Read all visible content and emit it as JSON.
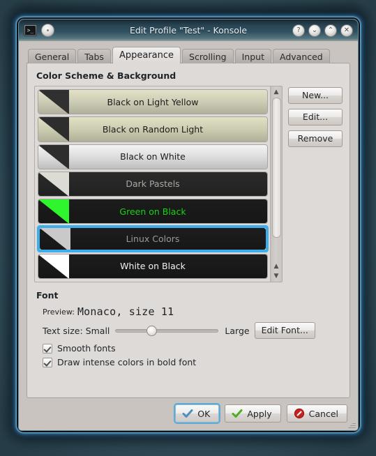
{
  "window": {
    "title": "Edit Profile \"Test\" - Konsole",
    "app_icon": "konsole-terminal-icon",
    "pin_icon": "pin-button-icon",
    "controls": {
      "help": "?",
      "minimize": "⌄",
      "maximize": "⌃",
      "close": "✕"
    }
  },
  "tabs": [
    {
      "label": "General",
      "active": false
    },
    {
      "label": "Tabs",
      "active": false
    },
    {
      "label": "Appearance",
      "active": true
    },
    {
      "label": "Scrolling",
      "active": false
    },
    {
      "label": "Input",
      "active": false
    },
    {
      "label": "Advanced",
      "active": false
    }
  ],
  "color_scheme_group": {
    "title": "Color Scheme & Background",
    "items": [
      {
        "label": "Black on Light Yellow",
        "bg": "#e3e2c8",
        "fg": "#1b1b1b",
        "corner": "#303030",
        "selected": false
      },
      {
        "label": "Black on Random Light",
        "bg": "#e2e1c3",
        "fg": "#1b1b1b",
        "corner": "#2d2d2d",
        "selected": false
      },
      {
        "label": "Black on White",
        "bg": "#f4f4f4",
        "fg": "#1b1b1b",
        "corner": "#2d2d2d",
        "selected": false
      },
      {
        "label": "Dark Pastels",
        "bg": "#2a2a2a",
        "fg": "#a8a8a0",
        "corner": "#dcdcd4",
        "selected": false
      },
      {
        "label": "Green on Black",
        "bg": "#1c1c1c",
        "fg": "#18d318",
        "corner": "#2ef52e",
        "selected": false
      },
      {
        "label": "Linux Colors",
        "bg": "#1d1d1d",
        "fg": "#9a9a9a",
        "corner": "#c9c9c9",
        "selected": true
      },
      {
        "label": "White on Black",
        "bg": "#1c1c1c",
        "fg": "#f2f2f2",
        "corner": "#ffffff",
        "selected": false
      }
    ],
    "buttons": [
      {
        "label": "New...",
        "name": "new-scheme-button"
      },
      {
        "label": "Edit...",
        "name": "edit-scheme-button"
      },
      {
        "label": "Remove",
        "name": "remove-scheme-button"
      }
    ],
    "selection_color": "#3daee9"
  },
  "font_group": {
    "title": "Font",
    "preview_label": "Preview:",
    "preview_value": "Monaco, size 11",
    "textsize_label": "Text size: Small",
    "large_label": "Large",
    "edit_font_label": "Edit Font...",
    "slider_position_percent": 35,
    "checkboxes": [
      {
        "label": "Smooth fonts",
        "checked": true
      },
      {
        "label": "Draw intense colors in bold font",
        "checked": true
      }
    ]
  },
  "dialog_buttons": [
    {
      "label": "OK",
      "icon": "blue-check-icon",
      "default": true
    },
    {
      "label": "Apply",
      "icon": "green-check-icon",
      "default": false
    },
    {
      "label": "Cancel",
      "icon": "red-cancel-icon",
      "default": false
    }
  ]
}
